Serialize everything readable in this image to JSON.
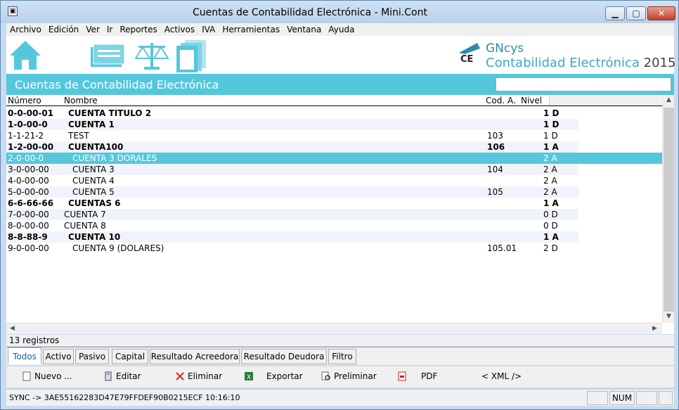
{
  "window": {
    "title": "Cuentas de Contabilidad Electrónica - Mini.Cont"
  },
  "menu": [
    "Archivo",
    "Edición",
    "Ver",
    "Ir",
    "Reportes",
    "Activos",
    "IVA",
    "Herramientas",
    "Ventana",
    "Ayuda"
  ],
  "brand": {
    "logo": "CE",
    "name": "GNcys",
    "subtitle": "Contabilidad Electrónica",
    "year": "2015"
  },
  "banner": {
    "title": "Cuentas de Contabilidad Electrónica",
    "search_value": ""
  },
  "grid": {
    "headers": {
      "numero": "Número",
      "nombre": "Nombre",
      "cod": "Cod. A.",
      "nivel": "Nivel"
    },
    "rows": [
      {
        "numero": "0-0-00-01",
        "nombre": "CUENTA TITULO 2",
        "cod": "",
        "nivel": "1 D",
        "bold": true,
        "indent": 1
      },
      {
        "numero": "1-0-00-0",
        "nombre": "CUENTA 1",
        "cod": "",
        "nivel": "1 D",
        "bold": true,
        "indent": 1
      },
      {
        "numero": "1-1-21-2",
        "nombre": "TEST",
        "cod": "103",
        "nivel": "1 D",
        "bold": false,
        "indent": 1
      },
      {
        "numero": "1-2-00-00",
        "nombre": "CUENTA100",
        "cod": "106",
        "nivel": "1 A",
        "bold": true,
        "indent": 1
      },
      {
        "numero": "2-0-00-0",
        "nombre": "CUENTA 3 DORALES",
        "cod": "",
        "nivel": "2 A",
        "bold": false,
        "indent": 2,
        "selected": true
      },
      {
        "numero": "3-0-00-00",
        "nombre": "CUENTA 3",
        "cod": "104",
        "nivel": "2 A",
        "bold": false,
        "indent": 2
      },
      {
        "numero": "4-0-00-00",
        "nombre": "CUENTA 4",
        "cod": "",
        "nivel": "2 A",
        "bold": false,
        "indent": 2
      },
      {
        "numero": "5-0-00-00",
        "nombre": "CUENTA 5",
        "cod": "105",
        "nivel": "2 A",
        "bold": false,
        "indent": 2
      },
      {
        "numero": "6-6-66-66",
        "nombre": "CUENTAS 6",
        "cod": "",
        "nivel": "1 A",
        "bold": true,
        "indent": 1
      },
      {
        "numero": "7-0-00-00",
        "nombre": "CUENTA 7",
        "cod": "",
        "nivel": "0 D",
        "bold": false,
        "indent": 0
      },
      {
        "numero": "8-0-00-00",
        "nombre": "CUENTA 8",
        "cod": "",
        "nivel": "0 D",
        "bold": false,
        "indent": 0
      },
      {
        "numero": "8-8-88-9",
        "nombre": "CUENTA 10",
        "cod": "",
        "nivel": "1 A",
        "bold": true,
        "indent": 1
      },
      {
        "numero": "9-0-00-00",
        "nombre": "CUENTA 9 (DOLARES)",
        "cod": "105.01",
        "nivel": "2 D",
        "bold": false,
        "indent": 2
      }
    ]
  },
  "count_text": "13 registros",
  "tabs": [
    "Todos",
    "Activo",
    "Pasivo",
    "Capital",
    "Resultado Acreedora",
    "Resultado Deudora",
    "Filtro"
  ],
  "actions": {
    "nuevo": "Nuevo ...",
    "editar": "Editar",
    "eliminar": "Eliminar",
    "exportar": "Exportar",
    "preliminar": "Preliminar",
    "pdf": "PDF",
    "xml": "< XML />"
  },
  "status": {
    "text": "SYNC -> 3AE55162283D47E79FFDEF90B0215ECF 10:16:10",
    "num": "NUM"
  },
  "colors": {
    "accent": "#55c7dd",
    "brand_text": "#3fa6c6"
  }
}
